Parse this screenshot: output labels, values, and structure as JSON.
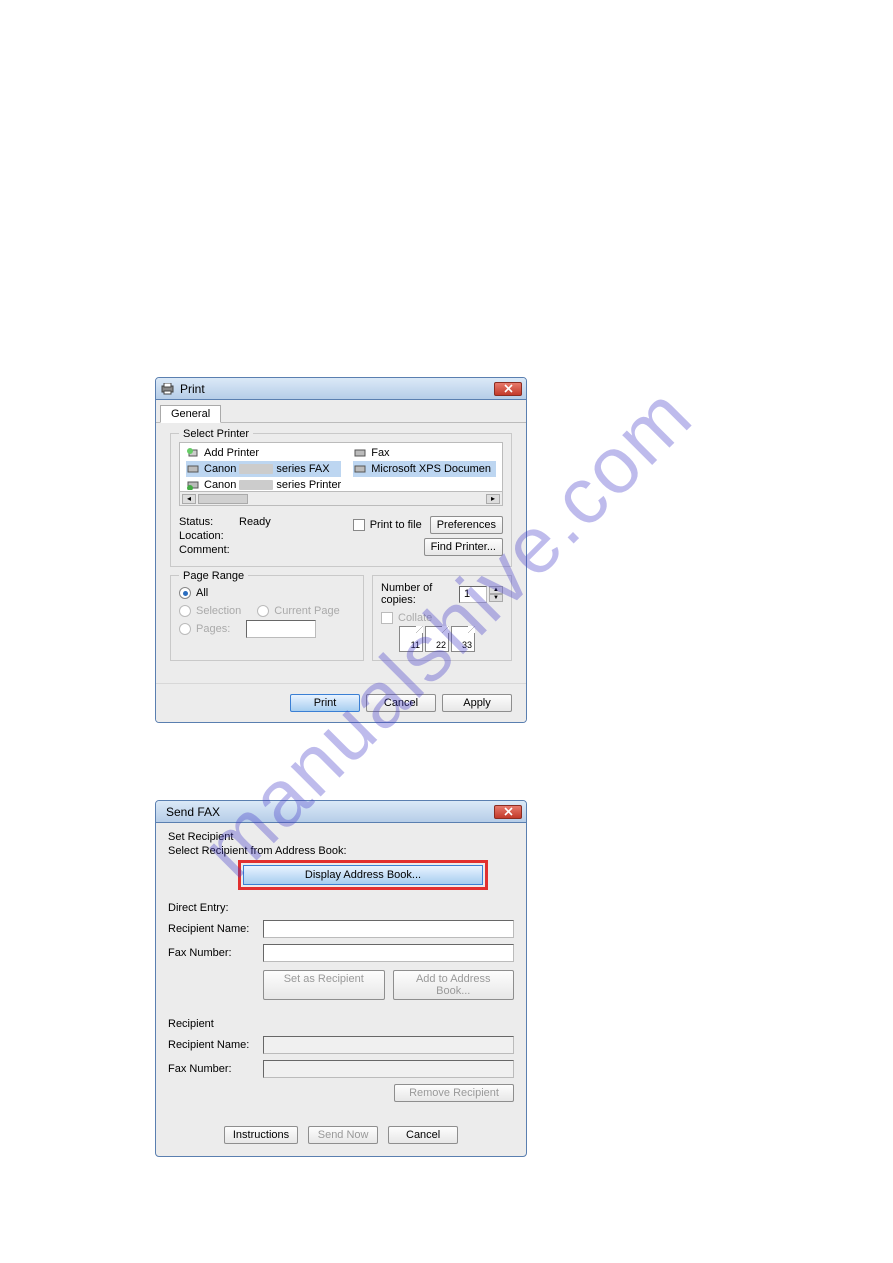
{
  "watermark": "manualshive.com",
  "print_dialog": {
    "title": "Print",
    "tab_general": "General",
    "select_printer_label": "Select Printer",
    "printers_col1": [
      "Add Printer",
      "Canon          series FAX",
      "Canon          series Printer"
    ],
    "printers_col2": [
      "Fax",
      "Microsoft XPS Documen"
    ],
    "status_k": "Status:",
    "status_v": "Ready",
    "location_k": "Location:",
    "comment_k": "Comment:",
    "print_to_file": "Print to file",
    "preferences": "Preferences",
    "find_printer": "Find Printer...",
    "page_range_label": "Page Range",
    "all": "All",
    "selection": "Selection",
    "current_page": "Current Page",
    "pages": "Pages:",
    "copies_label": "Number of copies:",
    "copies_value": "1",
    "collate": "Collate",
    "page_nums": [
      "11",
      "22",
      "33"
    ],
    "footer_print": "Print",
    "footer_cancel": "Cancel",
    "footer_apply": "Apply"
  },
  "fax_dialog": {
    "title": "Send FAX",
    "set_recipient": "Set Recipient",
    "select_from_book": "Select Recipient from Address Book:",
    "display_book": "Display Address Book...",
    "direct_entry": "Direct Entry:",
    "recipient_name": "Recipient Name:",
    "fax_number": "Fax Number:",
    "set_as_recipient": "Set as Recipient",
    "add_to_book": "Add to Address Book...",
    "recipient_section": "Recipient",
    "remove_recipient": "Remove Recipient",
    "instructions": "Instructions",
    "send_now": "Send Now",
    "cancel": "Cancel"
  }
}
